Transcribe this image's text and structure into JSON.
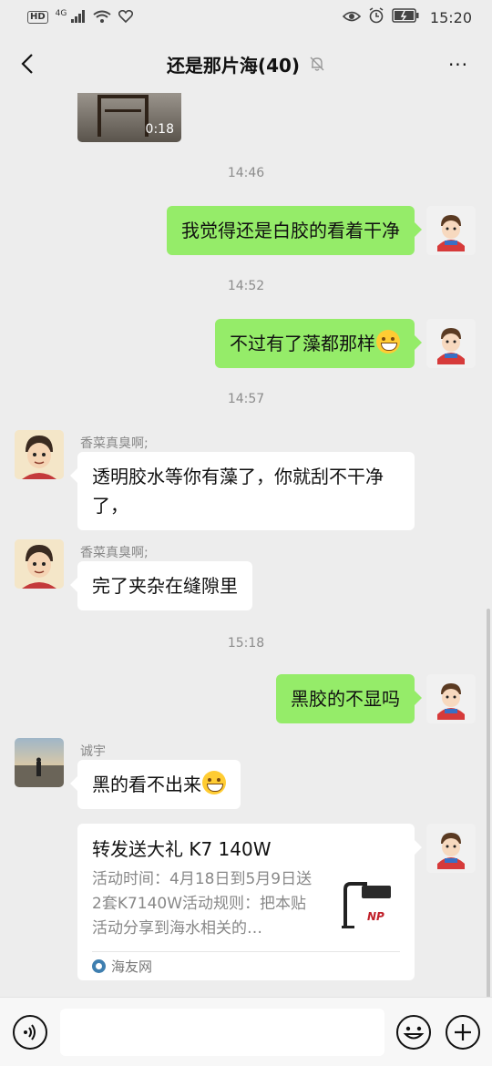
{
  "status_bar": {
    "hd_label": "HD",
    "network_label": "4G",
    "time": "15:20"
  },
  "header": {
    "title": "还是那片海(40)",
    "more_label": "···"
  },
  "video": {
    "duration": "0:18"
  },
  "timestamps": [
    "14:46",
    "14:52",
    "14:57",
    "15:18"
  ],
  "messages": [
    {
      "side": "me",
      "text": "我觉得还是白胶的看着干净"
    },
    {
      "side": "me",
      "text": "不过有了藻都那样",
      "emoji": "rolling-on-floor-laughing-emoji"
    },
    {
      "side": "other",
      "sender": "香菜真臭啊;",
      "text": "透明胶水等你有藻了，你就刮不干净了，"
    },
    {
      "side": "other",
      "sender": "香菜真臭啊;",
      "text": "完了夹杂在缝隙里"
    },
    {
      "side": "me",
      "text": "黑胶的不显吗"
    },
    {
      "side": "other",
      "sender": "诚宇",
      "text": "黑的看不出来",
      "emoji": "grinning-emoji"
    }
  ],
  "shared_card": {
    "title": "转发送大礼 K7 140W",
    "body": "活动时间：4月18日到5月9日送2套K7140W活动规则：把本贴活动分享到海水相关的…",
    "source": "海友网",
    "thumb_brand": "NP"
  },
  "input": {
    "placeholder": ""
  },
  "colors": {
    "background": "#ededed",
    "my_bubble": "#95ec69",
    "other_bubble": "#ffffff",
    "timestamp_text": "#8c8c8c"
  }
}
